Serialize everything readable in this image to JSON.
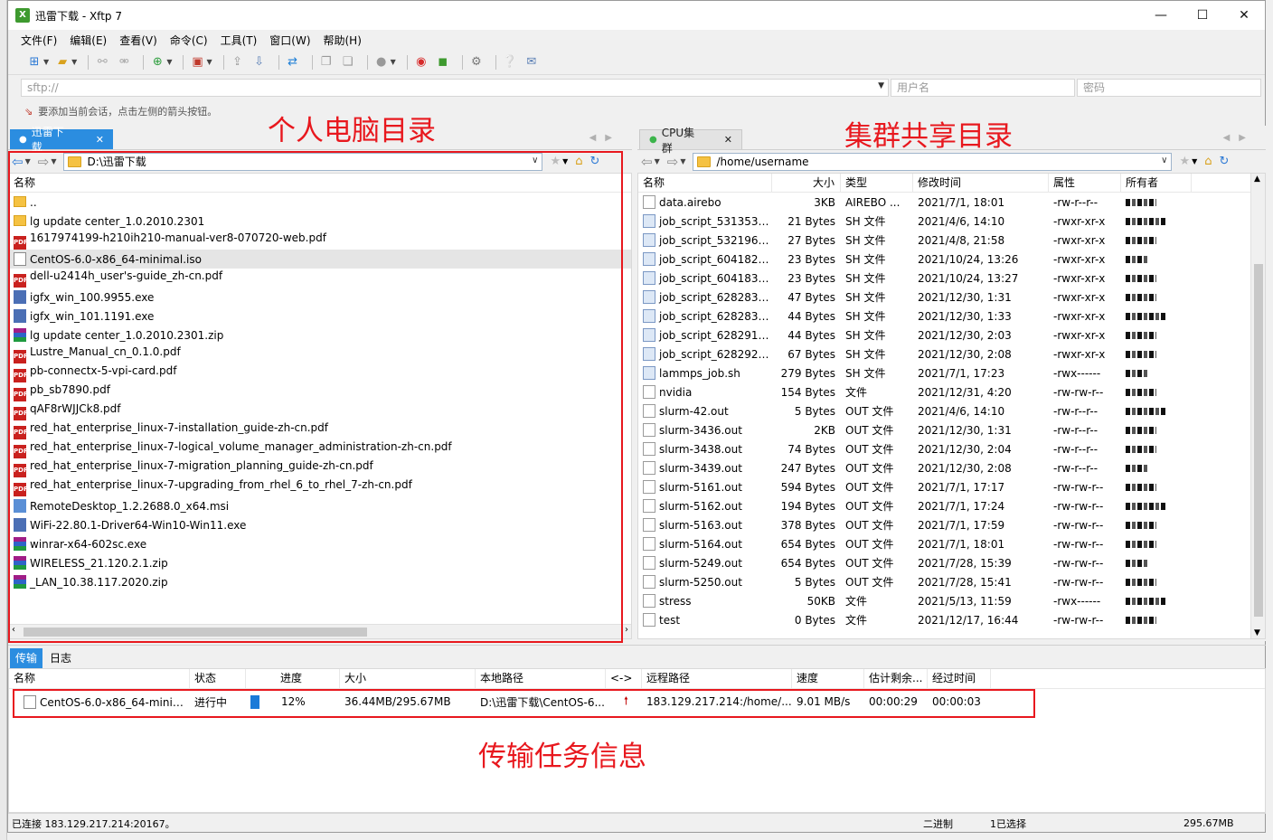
{
  "window": {
    "title": "迅雷下载 - Xftp 7",
    "app_icon_letter": "X"
  },
  "window_controls": {
    "minimize": "—",
    "maximize": "☐",
    "close": "✕"
  },
  "menu": [
    "文件(F)",
    "编辑(E)",
    "查看(V)",
    "命令(C)",
    "工具(T)",
    "窗口(W)",
    "帮助(H)"
  ],
  "address": {
    "value": "sftp://",
    "username_placeholder": "用户名",
    "password_placeholder": "密码"
  },
  "hint": "要添加当前会话，点击左侧的箭头按钮。",
  "annotations": {
    "local": "个人电脑目录",
    "remote": "集群共享目录",
    "transfer": "传输任务信息"
  },
  "local_pane": {
    "tab_label": "迅雷下载",
    "path": "D:\\迅雷下载",
    "column_name": "名称",
    "files": [
      {
        "name": "..",
        "type": "folder"
      },
      {
        "name": "lg update center_1.0.2010.2301",
        "type": "folder"
      },
      {
        "name": "1617974199-h210ih210-manual-ver8-070720-web.pdf",
        "type": "pdf"
      },
      {
        "name": "CentOS-6.0-x86_64-minimal.iso",
        "type": "iso"
      },
      {
        "name": "dell-u2414h_user's-guide_zh-cn.pdf",
        "type": "pdf"
      },
      {
        "name": "igfx_win_100.9955.exe",
        "type": "exe"
      },
      {
        "name": "igfx_win_101.1191.exe",
        "type": "exe"
      },
      {
        "name": "lg update center_1.0.2010.2301.zip",
        "type": "zip"
      },
      {
        "name": "Lustre_Manual_cn_0.1.0.pdf",
        "type": "pdf"
      },
      {
        "name": "pb-connectx-5-vpi-card.pdf",
        "type": "pdf"
      },
      {
        "name": "pb_sb7890.pdf",
        "type": "pdf"
      },
      {
        "name": "qAF8rWJJCk8.pdf",
        "type": "pdf"
      },
      {
        "name": "red_hat_enterprise_linux-7-installation_guide-zh-cn.pdf",
        "type": "pdf"
      },
      {
        "name": "red_hat_enterprise_linux-7-logical_volume_manager_administration-zh-cn.pdf",
        "type": "pdf"
      },
      {
        "name": "red_hat_enterprise_linux-7-migration_planning_guide-zh-cn.pdf",
        "type": "pdf"
      },
      {
        "name": "red_hat_enterprise_linux-7-upgrading_from_rhel_6_to_rhel_7-zh-cn.pdf",
        "type": "pdf"
      },
      {
        "name": "RemoteDesktop_1.2.2688.0_x64.msi",
        "type": "msi"
      },
      {
        "name": "WiFi-22.80.1-Driver64-Win10-Win11.exe",
        "type": "exe"
      },
      {
        "name": "winrar-x64-602sc.exe",
        "type": "zip"
      },
      {
        "name": "WIRELESS_21.120.2.1.zip",
        "type": "zip"
      },
      {
        "name": "_LAN_10.38.117.2020.zip",
        "type": "zip"
      }
    ]
  },
  "remote_pane": {
    "tab_label": "CPU集群",
    "path": "/home/username",
    "columns": [
      "名称",
      "大小",
      "类型",
      "修改时间",
      "属性",
      "所有者"
    ],
    "files": [
      {
        "name": "data.airebo",
        "size": "3KB",
        "type": "AIREBO ...",
        "modified": "2021/7/1, 18:01",
        "attr": "-rw-r--r--",
        "icon": "doc"
      },
      {
        "name": "job_script_5313535...",
        "size": "21 Bytes",
        "type": "SH 文件",
        "modified": "2021/4/6, 14:10",
        "attr": "-rwxr-xr-x",
        "icon": "sh"
      },
      {
        "name": "job_script_5321960...",
        "size": "27 Bytes",
        "type": "SH 文件",
        "modified": "2021/4/8, 21:58",
        "attr": "-rwxr-xr-x",
        "icon": "sh"
      },
      {
        "name": "job_script_6041829...",
        "size": "23 Bytes",
        "type": "SH 文件",
        "modified": "2021/10/24, 13:26",
        "attr": "-rwxr-xr-x",
        "icon": "sh"
      },
      {
        "name": "job_script_6041831...",
        "size": "23 Bytes",
        "type": "SH 文件",
        "modified": "2021/10/24, 13:27",
        "attr": "-rwxr-xr-x",
        "icon": "sh"
      },
      {
        "name": "job_script_6282832...",
        "size": "47 Bytes",
        "type": "SH 文件",
        "modified": "2021/12/30, 1:31",
        "attr": "-rwxr-xr-x",
        "icon": "sh"
      },
      {
        "name": "job_script_6282836...",
        "size": "44 Bytes",
        "type": "SH 文件",
        "modified": "2021/12/30, 1:33",
        "attr": "-rwxr-xr-x",
        "icon": "sh"
      },
      {
        "name": "job_script_6282913...",
        "size": "44 Bytes",
        "type": "SH 文件",
        "modified": "2021/12/30, 2:03",
        "attr": "-rwxr-xr-x",
        "icon": "sh"
      },
      {
        "name": "job_script_6282925...",
        "size": "67 Bytes",
        "type": "SH 文件",
        "modified": "2021/12/30, 2:08",
        "attr": "-rwxr-xr-x",
        "icon": "sh"
      },
      {
        "name": "lammps_job.sh",
        "size": "279 Bytes",
        "type": "SH 文件",
        "modified": "2021/7/1, 17:23",
        "attr": "-rwx------",
        "icon": "sh"
      },
      {
        "name": "nvidia",
        "size": "154 Bytes",
        "type": "文件",
        "modified": "2021/12/31, 4:20",
        "attr": "-rw-rw-r--",
        "icon": "doc"
      },
      {
        "name": "slurm-42.out",
        "size": "5 Bytes",
        "type": "OUT 文件",
        "modified": "2021/4/6, 14:10",
        "attr": "-rw-r--r--",
        "icon": "doc"
      },
      {
        "name": "slurm-3436.out",
        "size": "2KB",
        "type": "OUT 文件",
        "modified": "2021/12/30, 1:31",
        "attr": "-rw-r--r--",
        "icon": "doc"
      },
      {
        "name": "slurm-3438.out",
        "size": "74 Bytes",
        "type": "OUT 文件",
        "modified": "2021/12/30, 2:04",
        "attr": "-rw-r--r--",
        "icon": "doc"
      },
      {
        "name": "slurm-3439.out",
        "size": "247 Bytes",
        "type": "OUT 文件",
        "modified": "2021/12/30, 2:08",
        "attr": "-rw-r--r--",
        "icon": "doc"
      },
      {
        "name": "slurm-5161.out",
        "size": "594 Bytes",
        "type": "OUT 文件",
        "modified": "2021/7/1, 17:17",
        "attr": "-rw-rw-r--",
        "icon": "doc"
      },
      {
        "name": "slurm-5162.out",
        "size": "194 Bytes",
        "type": "OUT 文件",
        "modified": "2021/7/1, 17:24",
        "attr": "-rw-rw-r--",
        "icon": "doc"
      },
      {
        "name": "slurm-5163.out",
        "size": "378 Bytes",
        "type": "OUT 文件",
        "modified": "2021/7/1, 17:59",
        "attr": "-rw-rw-r--",
        "icon": "doc"
      },
      {
        "name": "slurm-5164.out",
        "size": "654 Bytes",
        "type": "OUT 文件",
        "modified": "2021/7/1, 18:01",
        "attr": "-rw-rw-r--",
        "icon": "doc"
      },
      {
        "name": "slurm-5249.out",
        "size": "654 Bytes",
        "type": "OUT 文件",
        "modified": "2021/7/28, 15:39",
        "attr": "-rw-rw-r--",
        "icon": "doc"
      },
      {
        "name": "slurm-5250.out",
        "size": "5 Bytes",
        "type": "OUT 文件",
        "modified": "2021/7/28, 15:41",
        "attr": "-rw-rw-r--",
        "icon": "doc"
      },
      {
        "name": "stress",
        "size": "50KB",
        "type": "文件",
        "modified": "2021/5/13, 11:59",
        "attr": "-rwx------",
        "icon": "doc"
      },
      {
        "name": "test",
        "size": "0 Bytes",
        "type": "文件",
        "modified": "2021/12/17, 16:44",
        "attr": "-rw-rw-r--",
        "icon": "doc"
      }
    ]
  },
  "transfer": {
    "tabs": [
      "传输",
      "日志"
    ],
    "columns": [
      "名称",
      "状态",
      "进度",
      "大小",
      "本地路径",
      "<->",
      "远程路径",
      "速度",
      "估计剩余...",
      "经过时间"
    ],
    "rows": [
      {
        "name": "CentOS-6.0-x86_64-minim...",
        "status": "进行中",
        "progress": "12%",
        "progress_fraction": 0.12,
        "size": "36.44MB/295.67MB",
        "local": "D:\\迅雷下载\\CentOS-6...",
        "remote": "183.129.217.214:/home/...",
        "speed": "9.01 MB/s",
        "remaining": "00:00:29",
        "elapsed": "00:00:03"
      }
    ]
  },
  "status": {
    "connection": "已连接 183.129.217.214:20167。",
    "mode": "二进制",
    "selected": "1已选择",
    "size": "295.67MB"
  },
  "colors": {
    "accent": "#2b8de0",
    "annotation": "#e8181e"
  }
}
